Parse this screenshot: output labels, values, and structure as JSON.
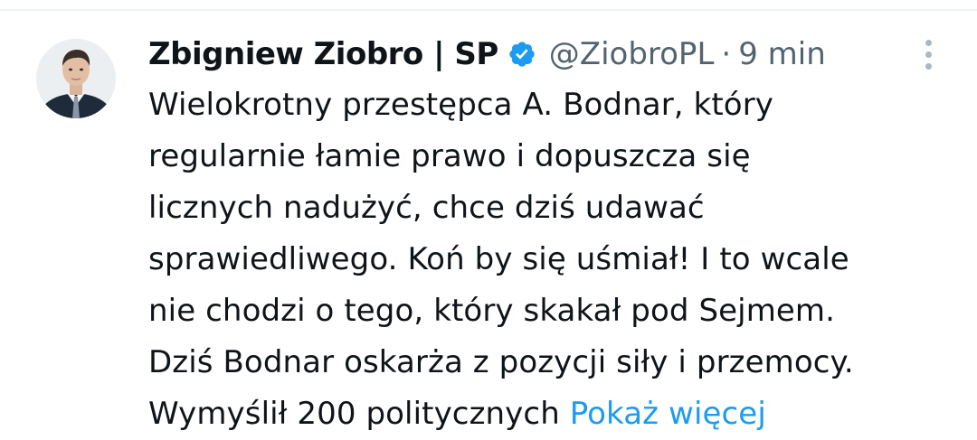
{
  "tweet": {
    "author": {
      "display_name": "Zbigniew Ziobro | SP",
      "handle": "@ZiobroPL",
      "separator": "·",
      "timestamp": "9 min",
      "verified": true,
      "avatar_icon": "profile-photo-avatar",
      "verified_icon": "verified-badge-icon"
    },
    "menu_icon": "more-vertical-icon",
    "text_lines": [
      "Wielokrotny przestępca A. Bodnar, który",
      "regularnie łamie prawo i dopuszcza się",
      "licznych nadużyć, chce dziś udawać",
      "sprawiedliwego. Koń by się uśmiał! I to wcale",
      "nie chodzi o tego, który skakał pod Sejmem.",
      "Dziś Bodnar oskarża z pozycji siły i przemocy.",
      "Wymyślił 200 politycznych "
    ],
    "show_more_label": "Pokaż więcej"
  },
  "colors": {
    "text_primary": "#0f1419",
    "text_secondary": "#536471",
    "link": "#1d9bf0",
    "verified_badge": "#1d9bf0",
    "divider": "#eff3f4",
    "menu_dots": "#aab8c2"
  }
}
